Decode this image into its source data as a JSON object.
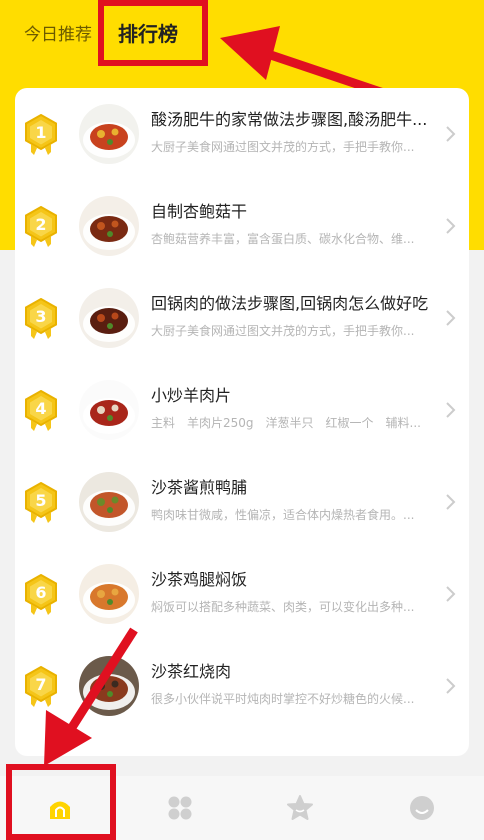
{
  "tabs": {
    "today": "今日推荐",
    "ranking": "排行榜"
  },
  "list": [
    {
      "rank": "1",
      "title": "酸汤肥牛的家常做法步骤图,酸汤肥牛...",
      "desc": "大厨子美食网通过图文并茂的方式，手把手教你..."
    },
    {
      "rank": "2",
      "title": "自制杏鲍菇干",
      "desc": "杏鲍菇营养丰富，富含蛋白质、碳水化合物、维..."
    },
    {
      "rank": "3",
      "title": "回锅肉的做法步骤图,回锅肉怎么做好吃",
      "desc": "大厨子美食网通过图文并茂的方式，手把手教你..."
    },
    {
      "rank": "4",
      "title": "小炒羊肉片",
      "desc": "主料　羊肉片250g　洋葱半只　红椒一个　辅料..."
    },
    {
      "rank": "5",
      "title": "沙茶酱煎鸭脯",
      "desc": "鸭肉味甘微咸，性偏凉，适合体内燥热者食用。..."
    },
    {
      "rank": "6",
      "title": "沙茶鸡腿焖饭",
      "desc": "焖饭可以搭配多种蔬菜、肉类，可以变化出多种..."
    },
    {
      "rank": "7",
      "title": "沙茶红烧肉",
      "desc": "很多小伙伴说平时炖肉时掌控不好炒糖色的火候..."
    }
  ],
  "colors": {
    "accent": "#FFDD00",
    "highlight": "#e01020",
    "medal": "#f5c518"
  },
  "nav": [
    {
      "icon": "home-icon",
      "active": true
    },
    {
      "icon": "category-icon",
      "active": false
    },
    {
      "icon": "star-icon",
      "active": false
    },
    {
      "icon": "profile-icon",
      "active": false
    }
  ]
}
